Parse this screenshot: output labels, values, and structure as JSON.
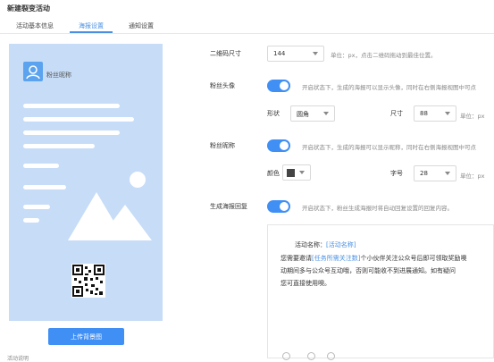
{
  "page_title": "新建裂变活动",
  "tabs": [
    {
      "label": "活动基本信息",
      "active": false
    },
    {
      "label": "海报设置",
      "active": true
    },
    {
      "label": "通知设置",
      "active": false
    }
  ],
  "poster": {
    "nickname_placeholder": "粉丝昵称",
    "upload_button": "上传背景图",
    "bg_color": "#c6dcf7"
  },
  "bottom_left_text": "活动说明",
  "settings": {
    "qr_size": {
      "label": "二维码尺寸",
      "value": "144",
      "hint": "单位：px，点击二维码拖动到最佳位置。"
    },
    "avatar": {
      "label": "粉丝头像",
      "toggle_on": true,
      "hint": "开启状态下，生成的海报可以显示头像，同时在右侧海报视图中可点",
      "shape_label": "形状",
      "shape_value": "圆角",
      "size_label": "尺寸",
      "size_value": "88",
      "size_unit": "单位：px"
    },
    "nickname": {
      "label": "粉丝昵称",
      "toggle_on": true,
      "hint": "开启状态下，生成的海报可以显示昵称，同时在右侧海报视图中可点",
      "color_label": "颜色",
      "color_value": "#444444",
      "font_label": "字号",
      "font_value": "28",
      "font_unit": "单位：px"
    },
    "reply": {
      "label": "生成海报回复",
      "toggle_on": true,
      "hint": "开启状态下，粉丝生成海报时将自动回复设置的回复内容。"
    }
  },
  "editor": {
    "activity_prefix": "活动名称：",
    "activity_link": "[活动名称]",
    "line2_a": "您需要邀请",
    "line2_link": "[任务所需关注数]",
    "line2_b": "个小伙伴关注公众号后即可领取奖励噢",
    "line3": "动期间多与公众号互动哦，否则可能收不到进展通知。如有疑问",
    "line4": "您可直接使用噢。"
  },
  "accent_color": "#3f8ff5"
}
